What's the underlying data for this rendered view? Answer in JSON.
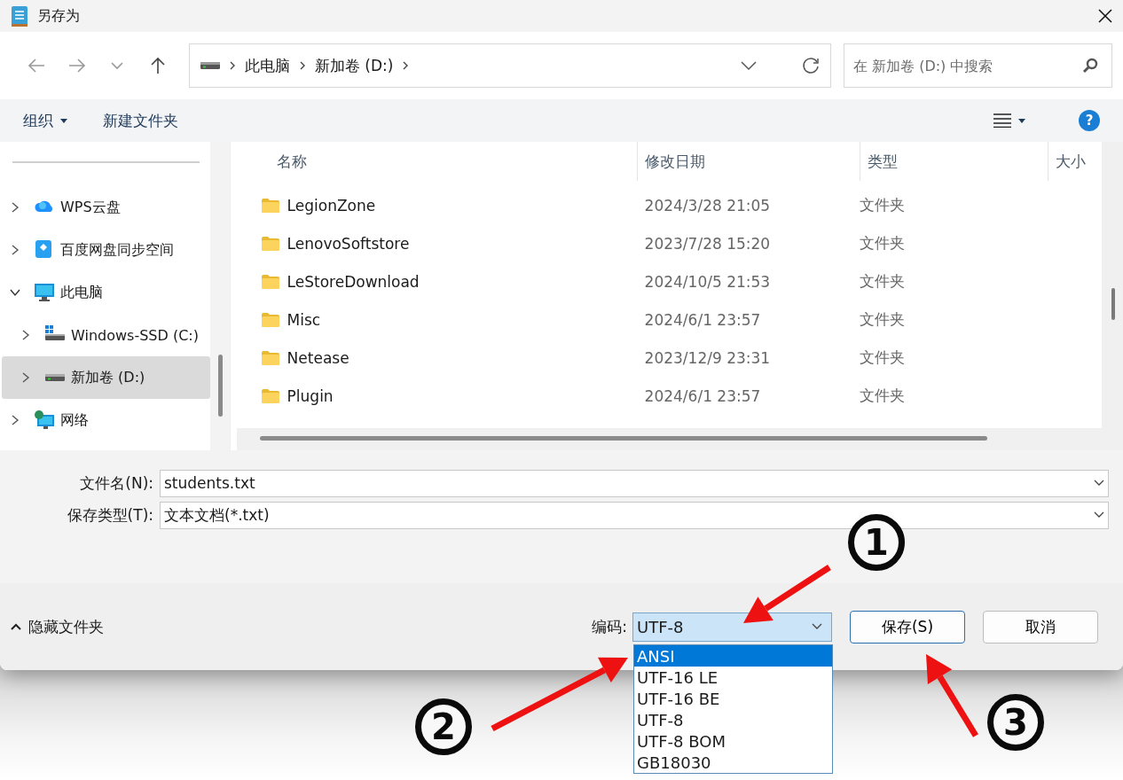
{
  "window": {
    "title": "另存为"
  },
  "address": {
    "segments": [
      "此电脑",
      "新加卷 (D:)"
    ]
  },
  "search": {
    "placeholder": "在 新加卷 (D:) 中搜索"
  },
  "toolbar": {
    "organize": "组织",
    "new_folder": "新建文件夹",
    "help": "?"
  },
  "sidebar": {
    "items": [
      {
        "label": "WPS云盘",
        "kind": "cloud",
        "expanded": false,
        "selected": false
      },
      {
        "label": "百度网盘同步空间",
        "kind": "sync",
        "expanded": false,
        "selected": false
      },
      {
        "label": "此电脑",
        "kind": "pc",
        "expanded": true,
        "selected": false,
        "children": [
          {
            "label": "Windows-SSD (C:)",
            "kind": "system-drive",
            "expanded": false,
            "selected": false
          },
          {
            "label": "新加卷 (D:)",
            "kind": "drive",
            "expanded": false,
            "selected": true
          }
        ]
      },
      {
        "label": "网络",
        "kind": "network",
        "expanded": false,
        "selected": false
      }
    ]
  },
  "table": {
    "columns": [
      "名称",
      "修改日期",
      "类型",
      "大小"
    ],
    "rows": [
      [
        "LegionZone",
        "2024/3/28 21:05",
        "文件夹"
      ],
      [
        "LenovoSoftstore",
        "2023/7/28 15:20",
        "文件夹"
      ],
      [
        "LeStoreDownload",
        "2024/10/5 21:53",
        "文件夹"
      ],
      [
        "Misc",
        "2024/6/1 23:57",
        "文件夹"
      ],
      [
        "Netease",
        "2023/12/9 23:31",
        "文件夹"
      ],
      [
        "Plugin",
        "2024/6/1 23:57",
        "文件夹"
      ]
    ]
  },
  "fields": [
    {
      "label": "文件名(N):",
      "value": "students.txt"
    },
    {
      "label": "保存类型(T):",
      "value": "文本文档(*.txt)"
    }
  ],
  "footer": {
    "hide_folders": "隐藏文件夹",
    "encoding_label": "编码:",
    "encoding_value": "UTF-8",
    "encoding_options": [
      {
        "label": "ANSI",
        "selected": true
      },
      {
        "label": "UTF-16 LE",
        "selected": false
      },
      {
        "label": "UTF-16 BE",
        "selected": false
      },
      {
        "label": "UTF-8",
        "selected": false
      },
      {
        "label": "UTF-8 BOM",
        "selected": false
      },
      {
        "label": "GB18030",
        "selected": false
      }
    ],
    "buttons": [
      "保存(S)",
      "取消"
    ]
  },
  "annotations": [
    {
      "number": "1"
    },
    {
      "number": "2"
    },
    {
      "number": "3"
    }
  ]
}
